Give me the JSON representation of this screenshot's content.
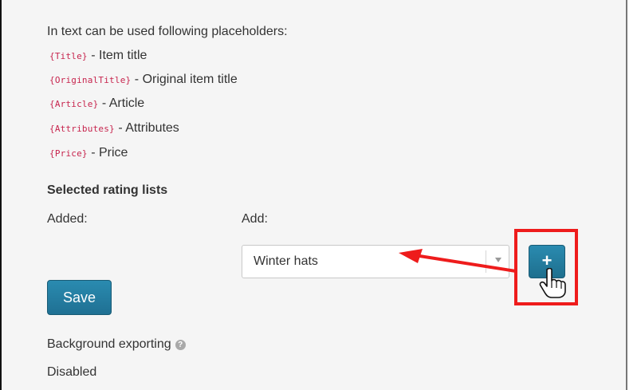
{
  "intro_text": "In text can be used following placeholders:",
  "placeholders": [
    {
      "code": "{Title}",
      "description": "- Item title"
    },
    {
      "code": "{OriginalTitle}",
      "description": "- Original item title"
    },
    {
      "code": "{Article}",
      "description": "- Article"
    },
    {
      "code": "{Attributes}",
      "description": "- Attributes"
    },
    {
      "code": "{Price}",
      "description": "- Price"
    }
  ],
  "rating_lists": {
    "title": "Selected rating lists",
    "added_label": "Added:",
    "add_label": "Add:",
    "select_value": "Winter hats",
    "add_button_label": "+"
  },
  "save_button_label": "Save",
  "background_exporting": {
    "label": "Background exporting",
    "help_icon": "?",
    "status": "Disabled"
  },
  "colors": {
    "annotation_red": "#ee1c1c",
    "button_teal": "#237ea3",
    "placeholder_code": "#c7254e"
  },
  "icons": {
    "help": "question-circle-icon",
    "cursor": "hand-pointer-icon",
    "annotation_arrow": "red-arrow-annotation"
  }
}
